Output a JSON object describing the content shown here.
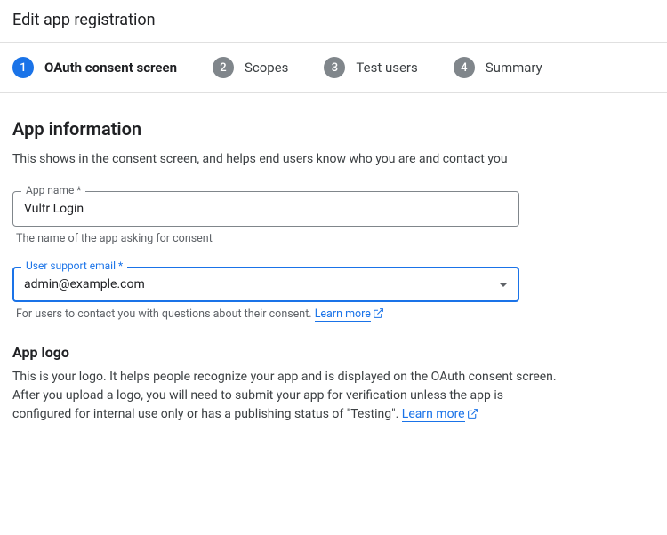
{
  "page_title": "Edit app registration",
  "stepper": {
    "steps": [
      {
        "num": "1",
        "label": "OAuth consent screen",
        "active": true
      },
      {
        "num": "2",
        "label": "Scopes",
        "active": false
      },
      {
        "num": "3",
        "label": "Test users",
        "active": false
      },
      {
        "num": "4",
        "label": "Summary",
        "active": false
      }
    ]
  },
  "app_info": {
    "title": "App information",
    "desc": "This shows in the consent screen, and helps end users know who you are and contact you",
    "app_name_label": "App name *",
    "app_name_value": "Vultr Login",
    "app_name_helper": "The name of the app asking for consent",
    "support_email_label": "User support email *",
    "support_email_value": "admin@example.com",
    "support_email_helper": "For users to contact you with questions about their consent. ",
    "learn_more": "Learn more"
  },
  "app_logo": {
    "title": "App logo",
    "desc1": "This is your logo. It helps people recognize your app and is displayed on the OAuth consent screen.",
    "desc2a": "After you upload a logo, you will need to submit your app for verification unless the app is configured for internal use only or has a publishing status of \"Testing\". ",
    "learn_more": "Learn more"
  }
}
